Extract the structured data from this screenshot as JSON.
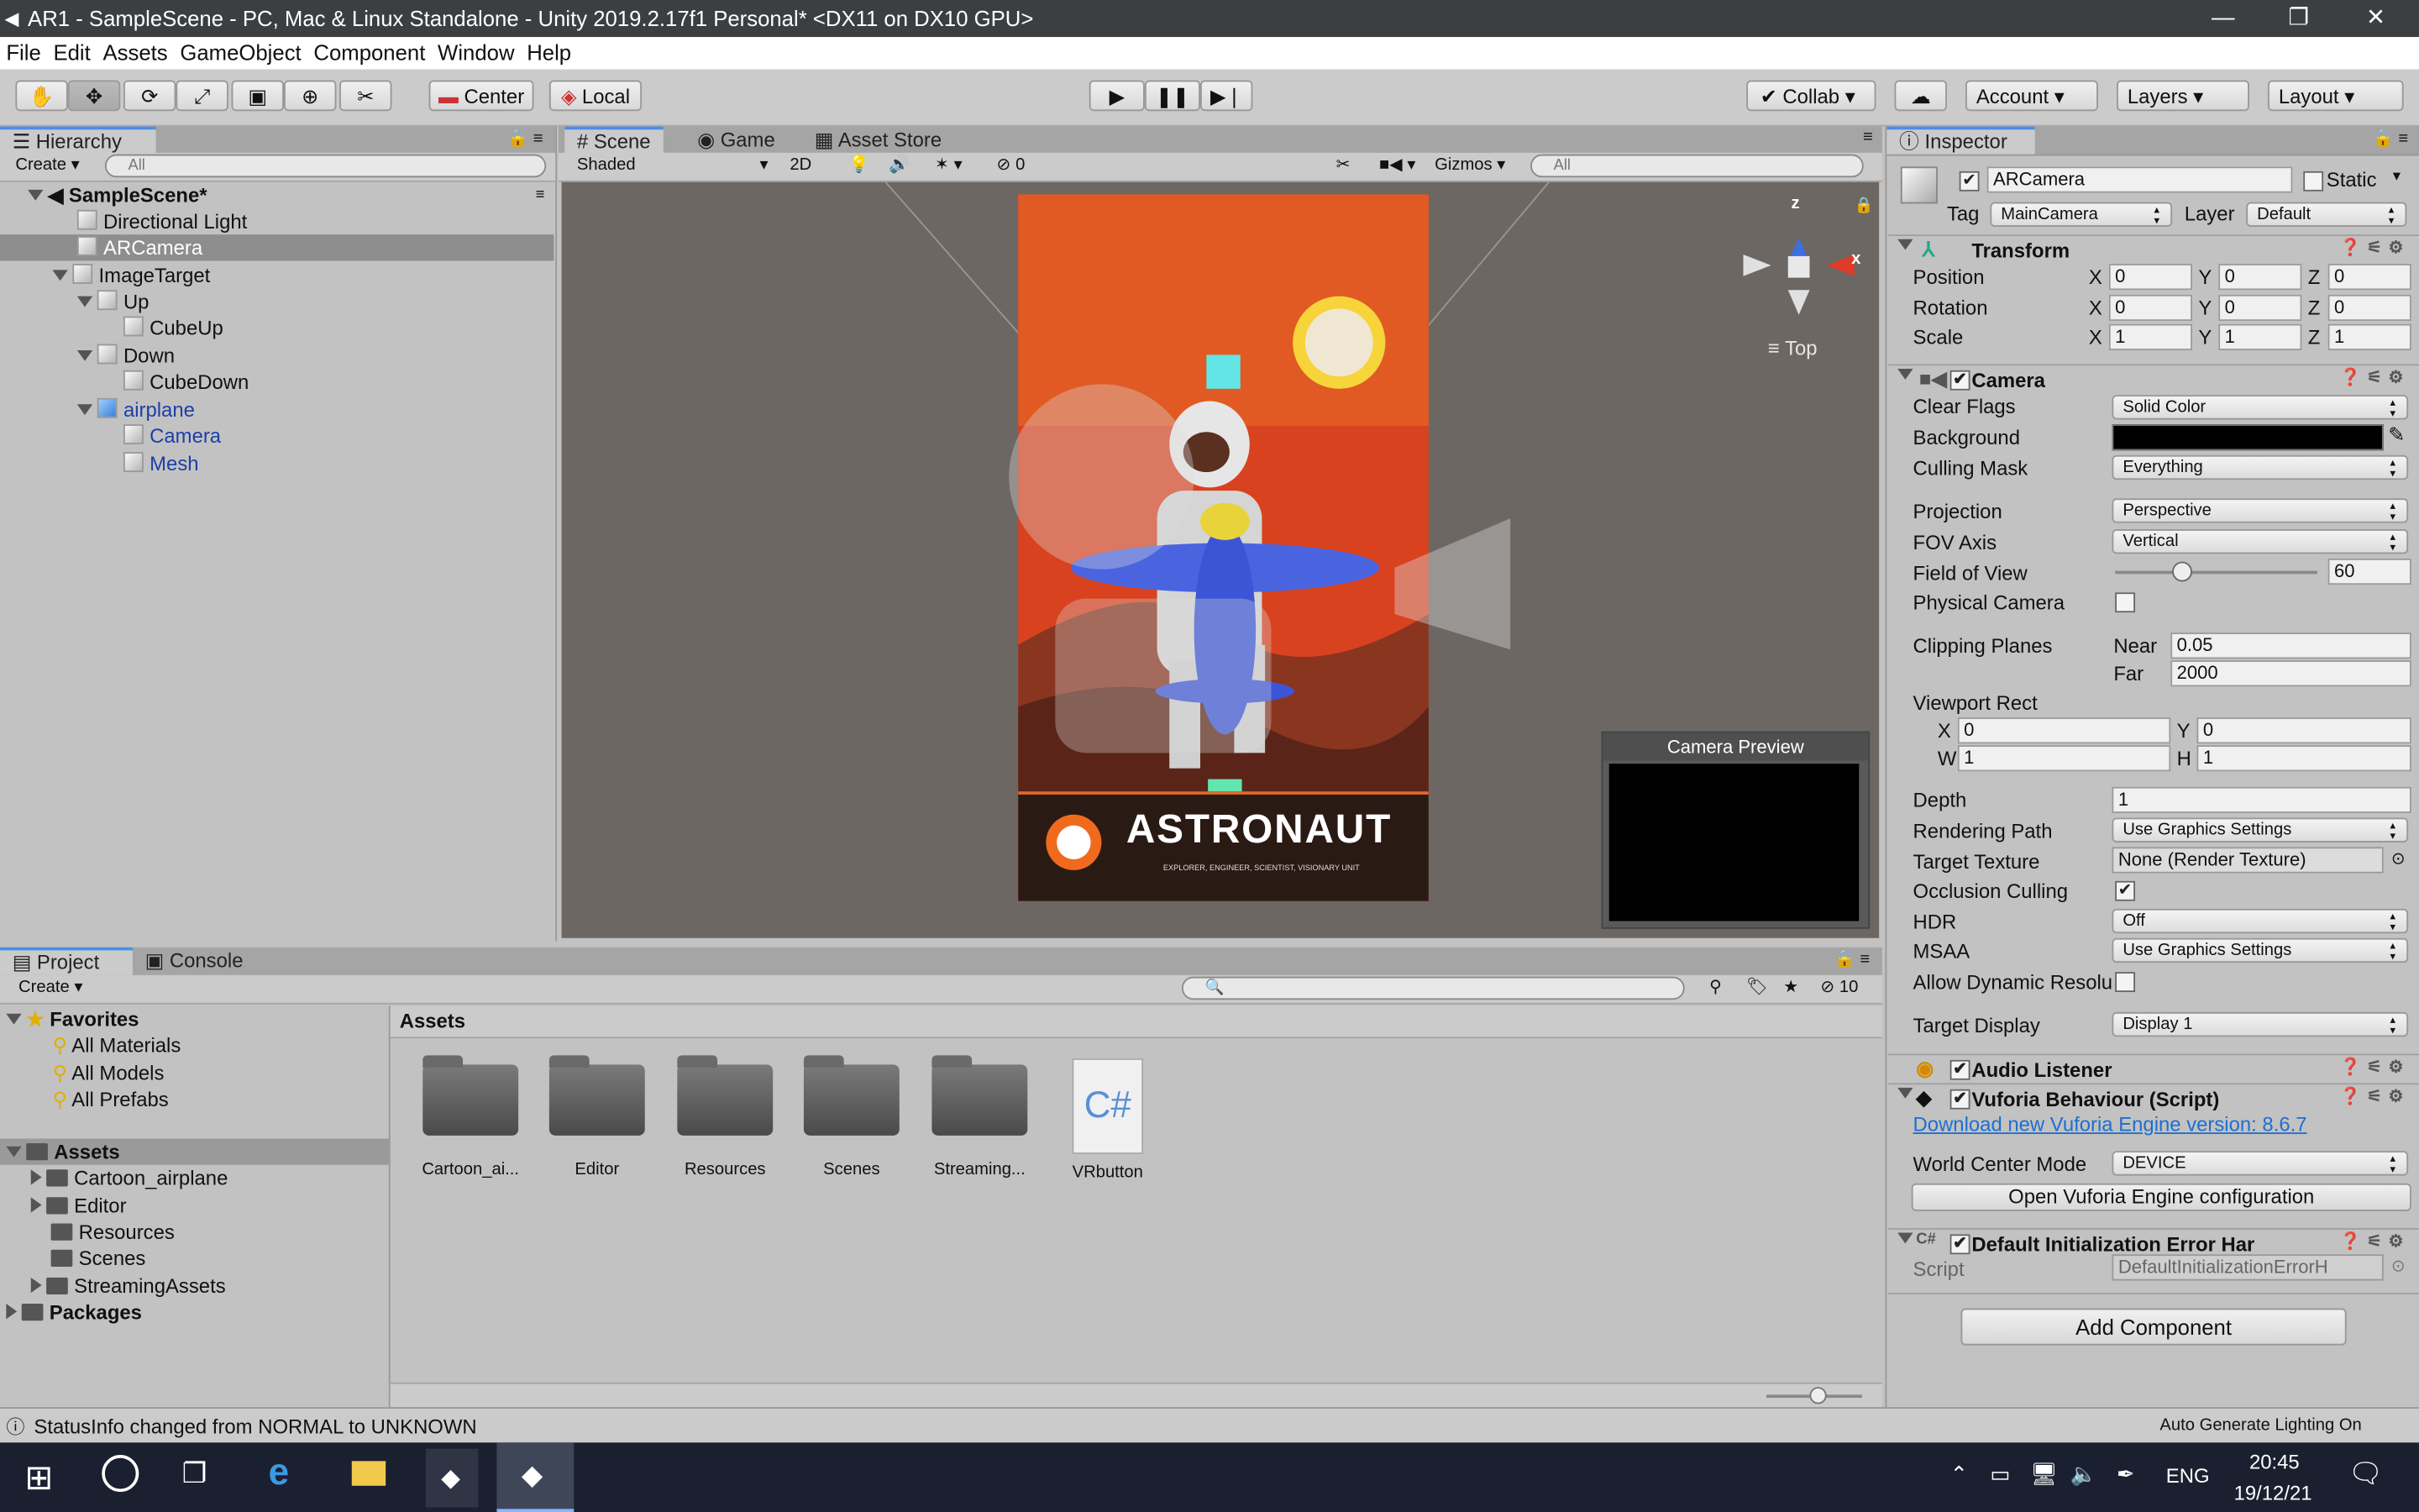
{
  "window": {
    "title": "AR1 - SampleScene - PC, Mac & Linux Standalone - Unity 2019.2.17f1 Personal* <DX11 on DX10 GPU>",
    "minimize": "—",
    "restore": "❐",
    "close": "✕"
  },
  "menu": [
    "File",
    "Edit",
    "Assets",
    "GameObject",
    "Component",
    "Window",
    "Help"
  ],
  "toolbar": {
    "pivot": "Center",
    "space": "Local",
    "collab": "Collab",
    "account": "Account",
    "layers": "Layers",
    "layout": "Layout"
  },
  "hierarchy": {
    "tab": "Hierarchy",
    "create": "Create",
    "search_placeholder": "All",
    "scene": "SampleScene*",
    "items": [
      "Directional Light",
      "ARCamera",
      "ImageTarget",
      "Up",
      "CubeUp",
      "Down",
      "CubeDown",
      "airplane",
      "Camera",
      "Mesh"
    ]
  },
  "scene": {
    "tabs": [
      "Scene",
      "Game",
      "Asset Store"
    ],
    "shading": "Shaded",
    "mode2d": "2D",
    "hidden_count": "0",
    "gizmos": "Gizmos",
    "search_placeholder": "All",
    "view_label": "Top",
    "target_title": "ASTRONAUT",
    "target_subtitle": "EXPLORER, ENGINEER, SCIENTIST, VISIONARY UNIT",
    "preview_title": "Camera Preview",
    "axis_x": "x",
    "axis_z": "z"
  },
  "project": {
    "tabs": [
      "Project",
      "Console"
    ],
    "create": "Create",
    "layer_count": "10",
    "favorites_label": "Favorites",
    "favorites": [
      "All Materials",
      "All Models",
      "All Prefabs"
    ],
    "assets_label": "Assets",
    "tree": [
      "Cartoon_airplane",
      "Editor",
      "Resources",
      "Scenes",
      "StreamingAssets"
    ],
    "packages_label": "Packages",
    "breadcrumb": "Assets",
    "grid": [
      "Cartoon_ai...",
      "Editor",
      "Resources",
      "Scenes",
      "Streaming...",
      "VRbutton"
    ],
    "script_glyph": "C#"
  },
  "status": {
    "message": "StatusInfo changed from NORMAL to UNKNOWN",
    "right": "Auto Generate Lighting On"
  },
  "inspector": {
    "tab": "Inspector",
    "object_name": "ARCamera",
    "static_label": "Static",
    "tag_label": "Tag",
    "tag": "MainCamera",
    "layer_label": "Layer",
    "layer": "Default",
    "transform": {
      "title": "Transform",
      "position_label": "Position",
      "rotation_label": "Rotation",
      "scale_label": "Scale",
      "axis": [
        "X",
        "Y",
        "Z"
      ],
      "position": [
        "0",
        "0",
        "0"
      ],
      "rotation": [
        "0",
        "0",
        "0"
      ],
      "scale": [
        "1",
        "1",
        "1"
      ]
    },
    "camera": {
      "title": "Camera",
      "clear_flags_label": "Clear Flags",
      "clear_flags": "Solid Color",
      "background_label": "Background",
      "background_color": "#000000",
      "culling_mask_label": "Culling Mask",
      "culling_mask": "Everything",
      "projection_label": "Projection",
      "projection": "Perspective",
      "fov_axis_label": "FOV Axis",
      "fov_axis": "Vertical",
      "fov_label": "Field of View",
      "fov": "60",
      "fov_min": 1,
      "fov_max": 179,
      "physical_label": "Physical Camera",
      "clipping_label": "Clipping Planes",
      "near_label": "Near",
      "near": "0.05",
      "far_label": "Far",
      "far": "2000",
      "viewport_label": "Viewport Rect",
      "vx_label": "X",
      "vx": "0",
      "vy_label": "Y",
      "vy": "0",
      "vw_label": "W",
      "vw": "1",
      "vh_label": "H",
      "vh": "1",
      "depth_label": "Depth",
      "depth": "1",
      "rendering_path_label": "Rendering Path",
      "rendering_path": "Use Graphics Settings",
      "target_texture_label": "Target Texture",
      "target_texture": "None (Render Texture)",
      "occlusion_label": "Occlusion Culling",
      "hdr_label": "HDR",
      "hdr": "Off",
      "msaa_label": "MSAA",
      "msaa": "Use Graphics Settings",
      "dynamic_res_label": "Allow Dynamic Resolu",
      "target_display_label": "Target Display",
      "target_display": "Display 1"
    },
    "audio_listener": "Audio Listener",
    "vuforia": {
      "title": "Vuforia Behaviour (Script)",
      "link": "Download new Vuforia Engine version: 8.6.7",
      "world_center_label": "World Center Mode",
      "world_center": "DEVICE",
      "open_config": "Open Vuforia Engine configuration"
    },
    "default_init": {
      "title": "Default Initialization Error Har",
      "script_label": "Script",
      "script": "DefaultInitializationErrorH"
    },
    "add_component": "Add Component"
  },
  "taskbar": {
    "lang": "ENG",
    "time": "20:45",
    "date": "19/12/21"
  },
  "colors": {
    "accent": "#4a8ee6",
    "selection": "#8e8e8e",
    "link": "#1d6fd1",
    "scene_bg": "#6d6763"
  }
}
